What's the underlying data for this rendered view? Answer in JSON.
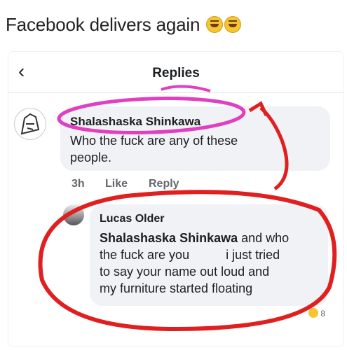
{
  "caption": {
    "text": "Facebook delivers again"
  },
  "header": {
    "back_icon": "chevron-left-icon",
    "title": "Replies"
  },
  "comment": {
    "author": "Shalashaska Shinkawa",
    "text_line1": "Who the fuck are any of these",
    "text_line2": "people.",
    "time": "3h",
    "like_label": "Like",
    "reply_label": "Reply"
  },
  "reply": {
    "author": "Lucas Older",
    "mention": "Shalashaska Shinkawa",
    "line1_rest": " and who",
    "line2_start": "the fuck are you ",
    "line2_end": " i just tried",
    "line3": "to say your name out loud and",
    "line4": "my furniture started floating",
    "reaction_count": "8"
  },
  "colors": {
    "annotation_pink": "#e040c0",
    "annotation_red": "#e02020",
    "bubble": "#f0f2f5"
  }
}
